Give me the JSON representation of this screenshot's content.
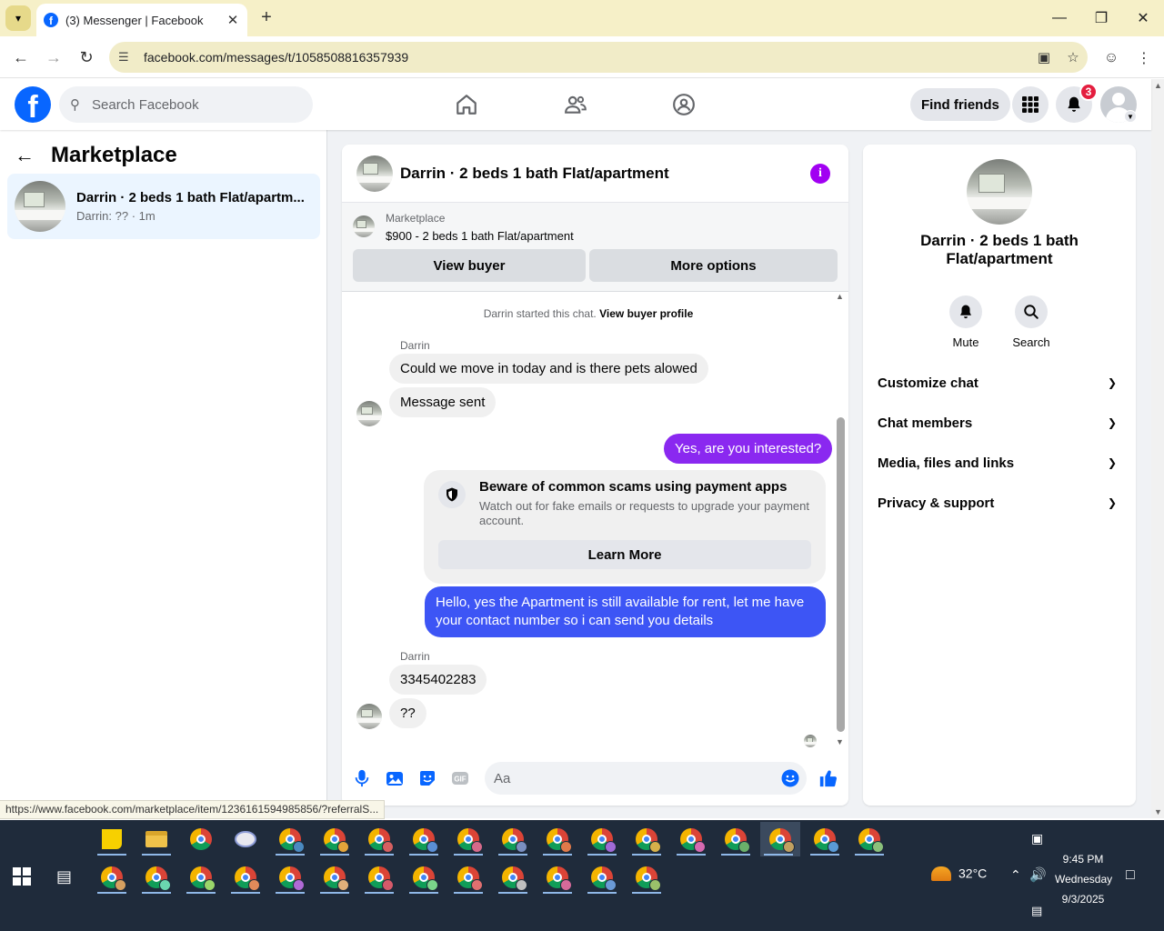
{
  "browser": {
    "tab_title": "(3) Messenger | Facebook",
    "url": "facebook.com/messages/t/1058508816357939",
    "status_url": "https://www.facebook.com/marketplace/item/1236161594985856/?referralS..."
  },
  "header": {
    "search_placeholder": "Search Facebook",
    "find_friends": "Find friends",
    "notification_count": "3"
  },
  "left": {
    "title": "Marketplace",
    "conversation": {
      "name": "Darrin · 2 beds 1 bath Flat/apartm...",
      "preview": "Darrin: ?? · 1m"
    }
  },
  "chat": {
    "title": "Darrin · 2 beds 1 bath Flat/apartment",
    "marketplace_label": "Marketplace",
    "listing": "$900 - 2 beds 1 bath Flat/apartment",
    "view_buyer": "View buyer",
    "more_options": "More options",
    "started_text": "Darrin started this chat.",
    "view_profile": "View buyer profile",
    "sender1": "Darrin",
    "msg1": "Could we move in today and is there pets alowed",
    "msg2": "Message sent",
    "msg3": "Yes, are you interested?",
    "scam_title": "Beware of common scams using payment apps",
    "scam_desc": "Watch out for fake emails or requests to upgrade your payment account.",
    "learn_more": "Learn More",
    "msg4": "Hello, yes the Apartment is still available for rent, let me have your contact number so i can send you details",
    "sender2": "Darrin",
    "msg5": "3345402283",
    "msg6": "??",
    "composer_placeholder": "Aa"
  },
  "right": {
    "name": "Darrin · 2 beds 1 bath Flat/apartment",
    "mute": "Mute",
    "search": "Search",
    "rows": [
      "Customize chat",
      "Chat members",
      "Media, files and links",
      "Privacy & support"
    ]
  },
  "taskbar": {
    "temperature": "32°C",
    "time": "9:45 PM",
    "day": "Wednesday",
    "date": "9/3/2025"
  },
  "colors": {
    "fb_blue": "#0866ff",
    "outgoing_purple": "#6f3cff",
    "outgoing_blue": "#3d55f5",
    "info_purple": "#a100f2",
    "badge_red": "#e41e3f"
  }
}
